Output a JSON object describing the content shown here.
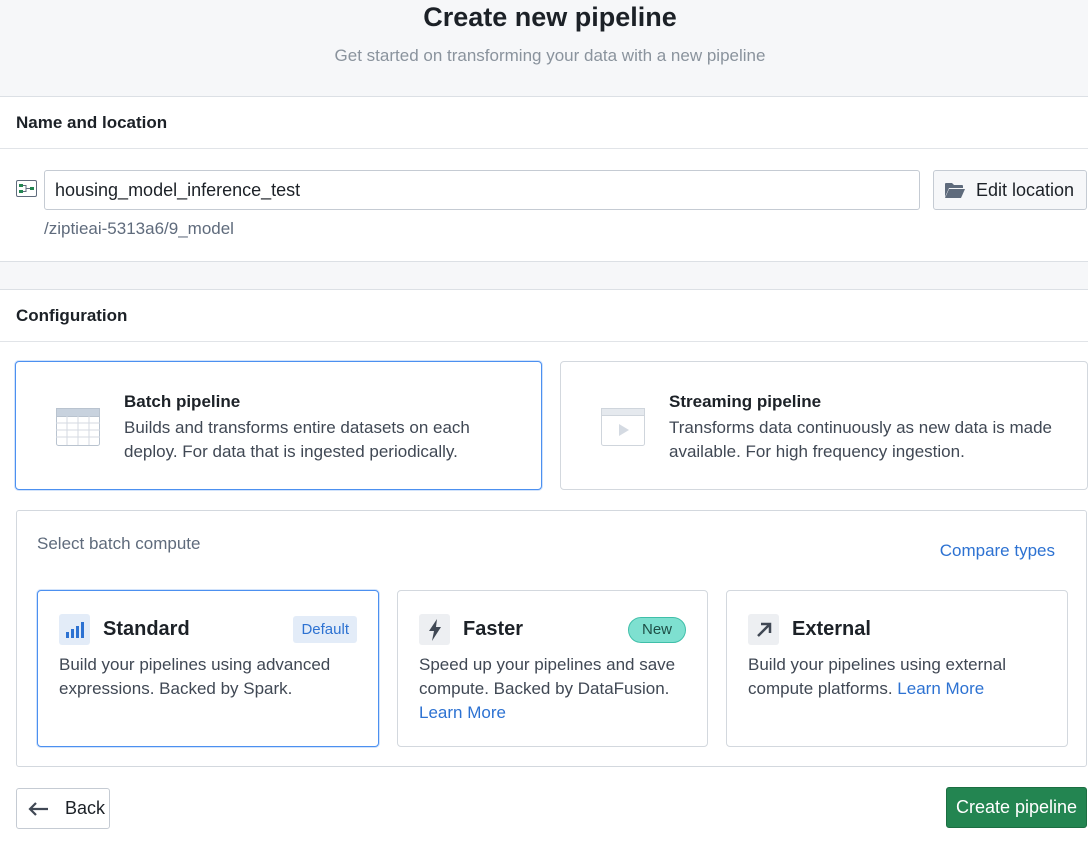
{
  "header": {
    "title": "Create new pipeline",
    "subtitle": "Get started on transforming your data with a new pipeline"
  },
  "name_section": {
    "heading": "Name and location",
    "pipeline_name_value": "housing_model_inference_test",
    "edit_location_label": "Edit location",
    "location_path": "/ziptieai-5313a6/9_model",
    "icons": {
      "pipeline": "pipeline-icon",
      "folder": "folder-open-icon"
    }
  },
  "configuration": {
    "heading": "Configuration",
    "pipeline_types": [
      {
        "name": "Batch pipeline",
        "description": "Builds and transforms entire datasets on each deploy. For data that is ingested periodically.",
        "icon": "table-icon",
        "selected": true
      },
      {
        "name": "Streaming pipeline",
        "description": "Transforms data continuously as new data is made available. For high frequency ingestion.",
        "icon": "video-icon",
        "selected": false
      }
    ],
    "compute": {
      "label": "Select batch compute",
      "compare_link": "Compare types",
      "options": [
        {
          "name": "Standard",
          "badge": "Default",
          "description": "Build your pipelines using advanced expressions. Backed by Spark.",
          "learn_more": "",
          "icon": "bar-chart-icon",
          "selected": true
        },
        {
          "name": "Faster",
          "badge": "New",
          "description": "Speed up your pipelines and save compute. Backed by DataFusion.",
          "learn_more": "Learn More",
          "icon": "lightning-icon",
          "selected": false
        },
        {
          "name": "External",
          "badge": "",
          "description": "Build your pipelines using external compute platforms.",
          "learn_more": "Learn More",
          "icon": "arrow-top-right-icon",
          "selected": false
        }
      ]
    }
  },
  "footer": {
    "back_label": "Back",
    "create_label": "Create pipeline"
  },
  "colors": {
    "primary_blue": "#2d72d2",
    "selected_border": "#4c90f0",
    "create_green": "#238551",
    "new_badge": "#7ee0d0"
  }
}
